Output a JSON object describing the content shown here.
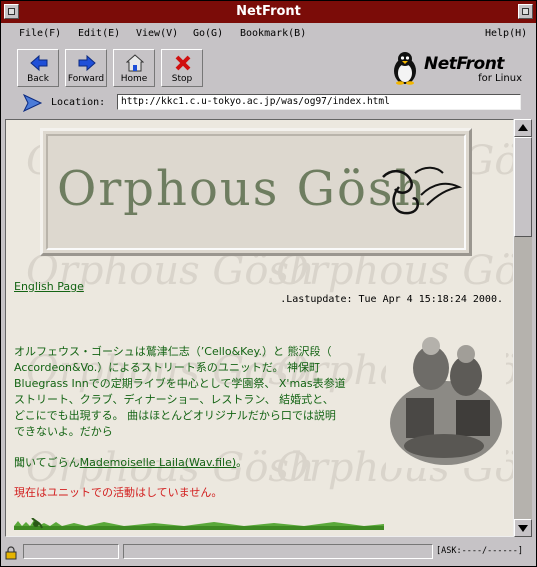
{
  "window": {
    "title": "NetFront"
  },
  "menu": {
    "file": "File(F)",
    "edit": "Edit(E)",
    "view": "View(V)",
    "go": "Go(G)",
    "bookmark": "Bookmark(B)",
    "help": "Help(H)"
  },
  "toolbar": {
    "back": "Back",
    "forward": "Forward",
    "home": "Home",
    "stop": "Stop"
  },
  "brand": {
    "name": "NetFront",
    "tagline": "for Linux"
  },
  "location": {
    "label": "Location:",
    "url": "http://kkc1.c.u-tokyo.ac.jp/was/og97/index.html"
  },
  "page": {
    "banner_text": "Orphous Gösh",
    "watermark_text": "Orphous Gösh",
    "english_link": "English Page",
    "lastupdate": ".Lastupdate: Tue Apr 4 15:18:24 2000.",
    "intro_lines": [
      "オルフェウス・ゴーシュは鷲津仁志（’Cello&Key.）と 熊沢段（",
      "Accordeon&Vo.）によるストリート系のユニットだ。 神保町",
      "Bluegrass Innでの定期ライブを中心として学園祭、 X'mas表参道",
      "ストリート、クラブ、ディナーショー、レストラン、 結婚式と、",
      "どこにでも出現する。 曲はほとんどオリジナルだから口では説明",
      "できないよ。だから"
    ],
    "listen_prefix": "聞いてごらん",
    "listen_link": "Mademoiselle Laila(Wav.file)",
    "listen_suffix": "。",
    "notice": "現在はユニットでの活動はしていません。"
  },
  "status": {
    "text": "[ASK:----/------]"
  },
  "colors": {
    "titlebar": "#7b0c08",
    "chrome": "#c6c3c6",
    "page_bg": "#ece8df",
    "text_green": "#146414",
    "notice_red": "#d21e1e",
    "watermark": "#d9d4cb",
    "logo_green": "#6e7d60"
  }
}
